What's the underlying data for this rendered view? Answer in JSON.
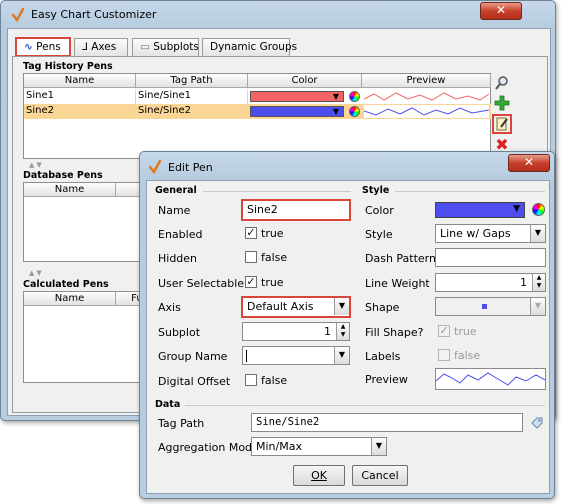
{
  "back_window": {
    "title": "Easy Chart Customizer",
    "tabs": [
      "Pens",
      "Axes",
      "Subplots",
      "Dynamic Groups"
    ],
    "tag_history": {
      "title": "Tag History Pens",
      "headers": [
        "Name",
        "Tag Path",
        "Color",
        "Preview"
      ],
      "rows": [
        {
          "name": "Sine1",
          "path": "Sine/Sine1",
          "color": "#f46464"
        },
        {
          "name": "Sine2",
          "path": "Sine/Sine2",
          "color": "#4d4df0"
        }
      ]
    },
    "database": {
      "title": "Database Pens",
      "headers": [
        "Name"
      ]
    },
    "calculated": {
      "title": "Calculated Pens",
      "headers": [
        "Name",
        "Fur"
      ]
    }
  },
  "edit_pen": {
    "title": "Edit Pen",
    "general": {
      "title": "General",
      "name_label": "Name",
      "name_value": "Sine2",
      "enabled_label": "Enabled",
      "enabled_text": "true",
      "hidden_label": "Hidden",
      "hidden_text": "false",
      "user_selectable_label": "User Selectable",
      "user_selectable_text": "true",
      "axis_label": "Axis",
      "axis_value": "Default Axis",
      "subplot_label": "Subplot",
      "subplot_value": "1",
      "group_name_label": "Group Name",
      "group_name_value": "",
      "digital_offset_label": "Digital Offset",
      "digital_offset_text": "false"
    },
    "style": {
      "title": "Style",
      "color_label": "Color",
      "color_value": "#4d4df0",
      "style_label": "Style",
      "style_value": "Line w/ Gaps",
      "dash_pattern_label": "Dash Pattern",
      "dash_pattern_value": "",
      "line_weight_label": "Line Weight",
      "line_weight_value": "1",
      "shape_label": "Shape",
      "fill_shape_label": "Fill Shape?",
      "fill_shape_text": "true",
      "labels_label": "Labels",
      "labels_text": "false",
      "preview_label": "Preview"
    },
    "data": {
      "title": "Data",
      "tag_path_label": "Tag Path",
      "tag_path_value": "Sine/Sine2",
      "aggregation_label": "Aggregation Mode",
      "aggregation_value": "Min/Max"
    },
    "buttons": {
      "ok": "OK",
      "cancel": "Cancel"
    }
  },
  "colors": {
    "highlight": "#d8463a",
    "selection": "#f9d596"
  }
}
